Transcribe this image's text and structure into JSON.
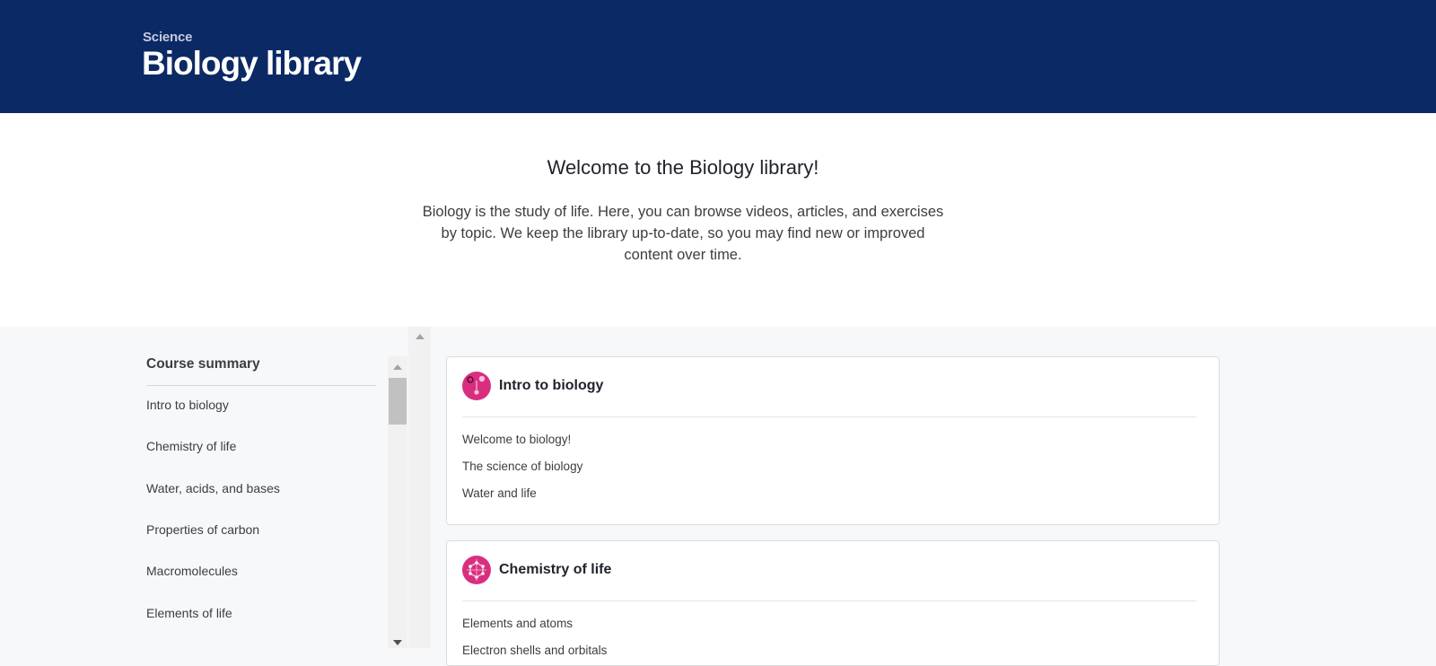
{
  "header": {
    "breadcrumb": "Science",
    "title": "Biology library",
    "background_color": "#0b2965"
  },
  "intro": {
    "title": "Welcome to the Biology library!",
    "description": "Biology is the study of life. Here, you can browse videos, articles, and exercises by topic. We keep the library up-to-date, so you may find new or improved content over time."
  },
  "sidebar": {
    "title": "Course summary",
    "items": [
      "Intro to biology",
      "Chemistry of life",
      "Water, acids, and bases",
      "Properties of carbon",
      "Macromolecules",
      "Elements of life"
    ]
  },
  "courses": [
    {
      "title": "Intro to biology",
      "icon": "microscope-icon",
      "lessons": [
        "Welcome to biology!",
        "The science of biology",
        "Water and life"
      ]
    },
    {
      "title": "Chemistry of life",
      "icon": "molecule-icon",
      "lessons": [
        "Elements and atoms",
        "Electron shells and orbitals"
      ]
    }
  ],
  "colors": {
    "accent": "#d92e7f",
    "card_border": "#dadcde"
  }
}
